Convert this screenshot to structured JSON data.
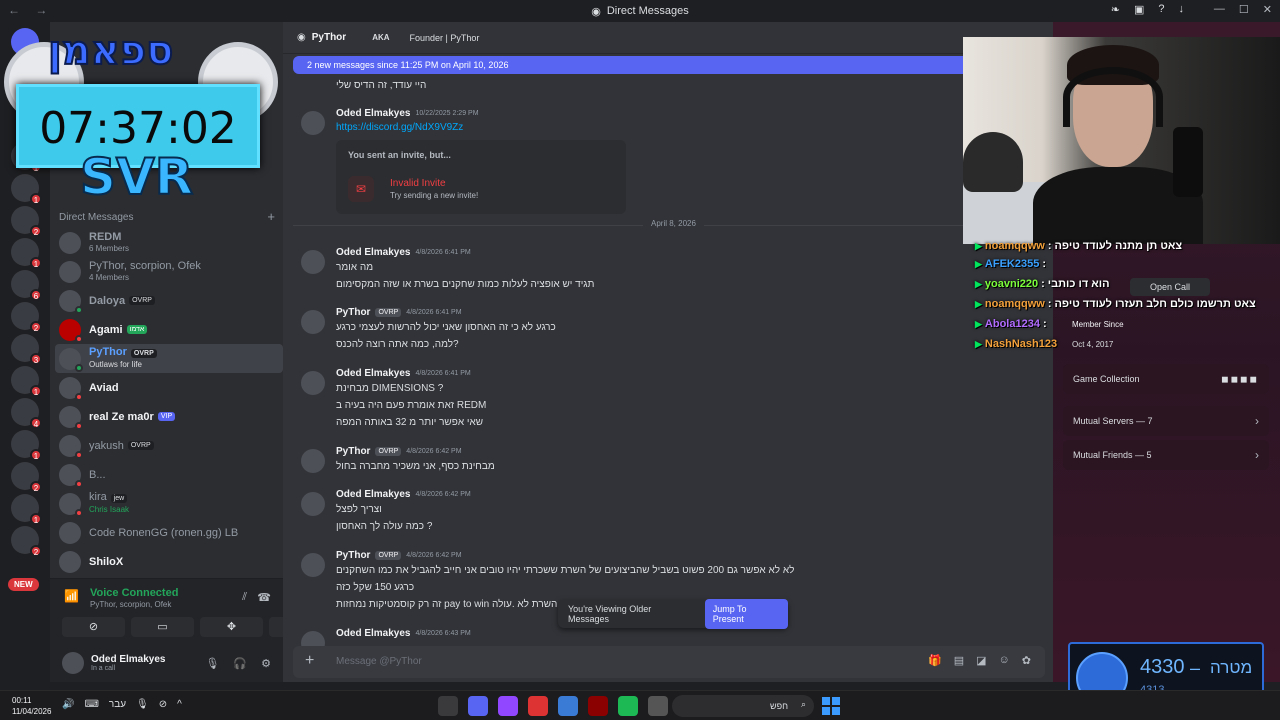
{
  "window": {
    "title": "Direct Messages",
    "nav": "← →"
  },
  "overlay": {
    "brand": "ספאמן",
    "clock": "07:37:02",
    "svr": "SVR"
  },
  "servers": {
    "new_label": "NEW"
  },
  "dm_panel": {
    "header": "Direct Messages",
    "plus": "+",
    "items": [
      {
        "name": "REDM",
        "sub": "6 Members",
        "tag": ""
      },
      {
        "name": "PyThor, scorpion, Ofek",
        "sub": "4 Members",
        "tag": ""
      },
      {
        "name": "Daloya",
        "sub": "",
        "tag": "OVRP"
      },
      {
        "name": "Agami",
        "sub": "",
        "tag": "אדמו"
      },
      {
        "name": "PyThor",
        "sub": "Outlaws for life",
        "tag": "OVRP"
      },
      {
        "name": "Aviad",
        "sub": "",
        "tag": ""
      },
      {
        "name": "real Ze ma0r",
        "sub": "",
        "tag": "VIP"
      },
      {
        "name": "yakush",
        "sub": "",
        "tag": "OVRP"
      },
      {
        "name": "B...",
        "sub": "",
        "tag": ""
      },
      {
        "name": "kira",
        "sub": "Chris Isaak",
        "tag": "jew"
      },
      {
        "name": "Code RonenGG (ronen.gg) LB",
        "sub": "",
        "tag": ""
      },
      {
        "name": "ShiloX",
        "sub": "",
        "tag": ""
      }
    ]
  },
  "voice": {
    "status": "Voice Connected",
    "channel": "PyThor, scorpion, Ofek"
  },
  "user_panel": {
    "name": "Oded Elmakyes",
    "status": "In a call"
  },
  "chat_header": {
    "name": "PyThor",
    "aka": "AKA",
    "founder": "Founder | PyThor"
  },
  "new_messages_bar": "2 new messages since 11:25 PM on April 10, 2026",
  "messages": {
    "m0": {
      "line": "היי עודד, זה הדיס שלי"
    },
    "m1": {
      "author": "Oded Elmakyes",
      "ts": "10/22/2025 2:29 PM",
      "link": "https://discord.gg/NdX9V9Zz"
    },
    "invite": {
      "header": "You sent an invite, but...",
      "title": "Invalid Invite",
      "sub": "Try sending a new invite!"
    },
    "date_divider": "April 8, 2026",
    "m2": {
      "author": "Oded Elmakyes",
      "ts": "4/8/2026 6:41 PM",
      "l1": "מה אומר",
      "l2": "תגיד יש אופציה לעלות כמות שחקנים בשרת או שזה המקסימום"
    },
    "m3": {
      "author": "PyThor",
      "tag": "OVRP",
      "ts": "4/8/2026 6:41 PM",
      "l1": "כרגע לא כי זה האחסון שאני יכול להרשות לעצמי כרגע",
      "l2": "למה, כמה אתה רוצה להכנס?"
    },
    "m4": {
      "author": "Oded Elmakyes",
      "ts": "4/8/2026 6:41 PM",
      "l1": "מבחינת DIMENSIONS ?",
      "l2": "זאת אומרת פעם היה בעיה ב REDM",
      "l3": "שאי אפשר יותר מ 32 באותה המפה"
    },
    "m5": {
      "author": "PyThor",
      "tag": "OVRP",
      "ts": "4/8/2026 6:42 PM",
      "l1": "מבחינת כסף, אני משכיר מחברה בחול"
    },
    "m6": {
      "author": "Oded Elmakyes",
      "ts": "4/8/2026 6:42 PM",
      "l1": "וצריך לפצל",
      "l2": "כמה עולה לך האחסון ?"
    },
    "m7": {
      "author": "PyThor",
      "tag": "OVRP",
      "ts": "4/8/2026 6:42 PM",
      "l1": "לא לא אפשר גם 200 פשוט בשביל שהביצועים של השרת ששכרתי יהיו טובים אני חייב להגביל את כמו השחקנים",
      "l2": "כרגע 150 שקל כזה",
      "l3": "זה רק קוסמטיקות נמחזות pay to win השרת לא .עולה"
    },
    "m8": {
      "author": "Oded Elmakyes",
      "ts": "4/8/2026 6:43 PM"
    }
  },
  "older_banner": {
    "text": "You're Viewing Older Messages",
    "jump": "Jump To Present"
  },
  "composer": {
    "placeholder": "Message @PyThor"
  },
  "profile": {
    "open_call": "Open Call",
    "member_since_label": "Member Since",
    "member_since": "Oct 4, 2017",
    "game_collection": "Game Collection",
    "mutual_servers": "Mutual Servers — 7",
    "mutual_friends": "Mutual Friends — 5"
  },
  "stream_chat": [
    {
      "user": "noamqqww",
      "msg": "צאט תן מתנה לעודד טיפה",
      "color": "#f3a13b"
    },
    {
      "user": "AFEK2355",
      "msg": "",
      "color": "#3aa0ff"
    },
    {
      "user": "yoavni220",
      "msg": "הוא דו כותבי",
      "color": "#7cff3b"
    },
    {
      "user": "noamqqww",
      "msg": "צאט תרשמו כולם חלב תעזרו לעודד טיפה",
      "color": "#f3a13b"
    },
    {
      "user": "Abola1234",
      "msg": "",
      "color": "#b26cff"
    },
    {
      "user": "NashNash123",
      "msg": "",
      "color": "#f3a13b"
    }
  ],
  "goal": {
    "value": "4330",
    "dash": "–",
    "label": "מטרה",
    "sub": "4313"
  },
  "taskbar": {
    "time": "00:11",
    "date": "11/04/2026",
    "lang": "עבר",
    "search": "חפש"
  },
  "colors": {
    "accent": "#5865f2",
    "online": "#23a55a",
    "dnd": "#f23f43"
  }
}
